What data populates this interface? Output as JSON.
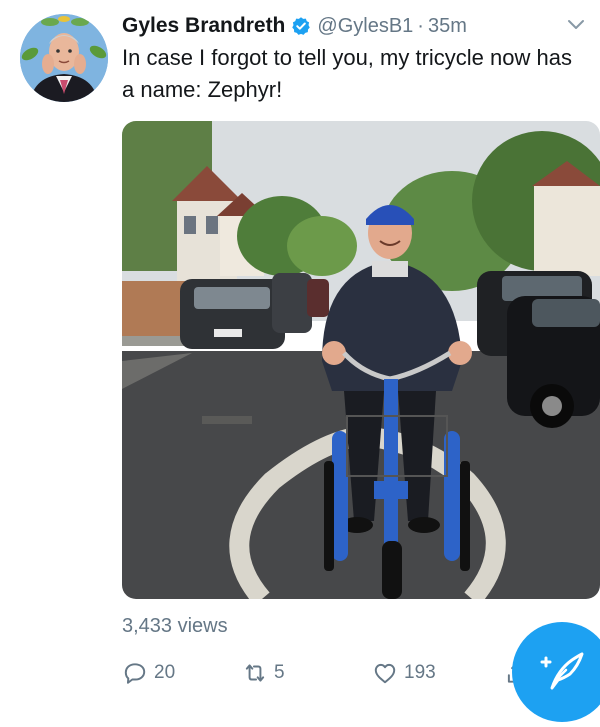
{
  "tweet": {
    "author_name": "Gyles Brandreth",
    "handle": "@GylesB1",
    "separator": "·",
    "time": "35m",
    "text": "In case I forgot to tell you, my tricycle now has a name: Zephyr!",
    "views": "3,433 views"
  },
  "actions": {
    "reply_count": "20",
    "retweet_count": "5",
    "like_count": "193"
  },
  "icons": {
    "verified": "verified-badge-icon",
    "menu": "chevron-down-icon",
    "reply": "reply-icon",
    "retweet": "retweet-icon",
    "like": "heart-icon",
    "share": "share-icon",
    "compose": "compose-tweet-icon"
  },
  "colors": {
    "accent": "#1da1f2",
    "text": "#14171a",
    "secondary": "#657786"
  }
}
